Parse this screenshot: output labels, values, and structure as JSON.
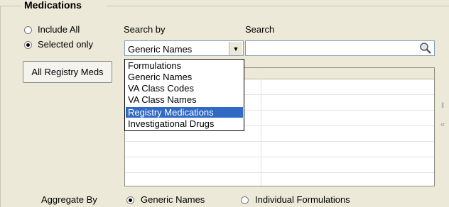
{
  "group": {
    "title": "Medications"
  },
  "scope_options": [
    {
      "label": "Include All",
      "checked": false
    },
    {
      "label": "Selected only",
      "checked": true
    }
  ],
  "all_registry_meds_button": "All Registry Meds",
  "search_by": {
    "label": "Search by",
    "selected": "Generic Names",
    "options": [
      "Formulations",
      "Generic Names",
      "VA Class Codes",
      "VA Class Names",
      "Registry Medications",
      "Investigational Drugs"
    ],
    "highlighted": "Registry Medications"
  },
  "search": {
    "label": "Search",
    "value": ""
  },
  "aggregate": {
    "label": "Aggregate By",
    "options": [
      {
        "label": "Generic Names",
        "checked": true
      },
      {
        "label": "Individual Formulations",
        "checked": false
      }
    ]
  }
}
